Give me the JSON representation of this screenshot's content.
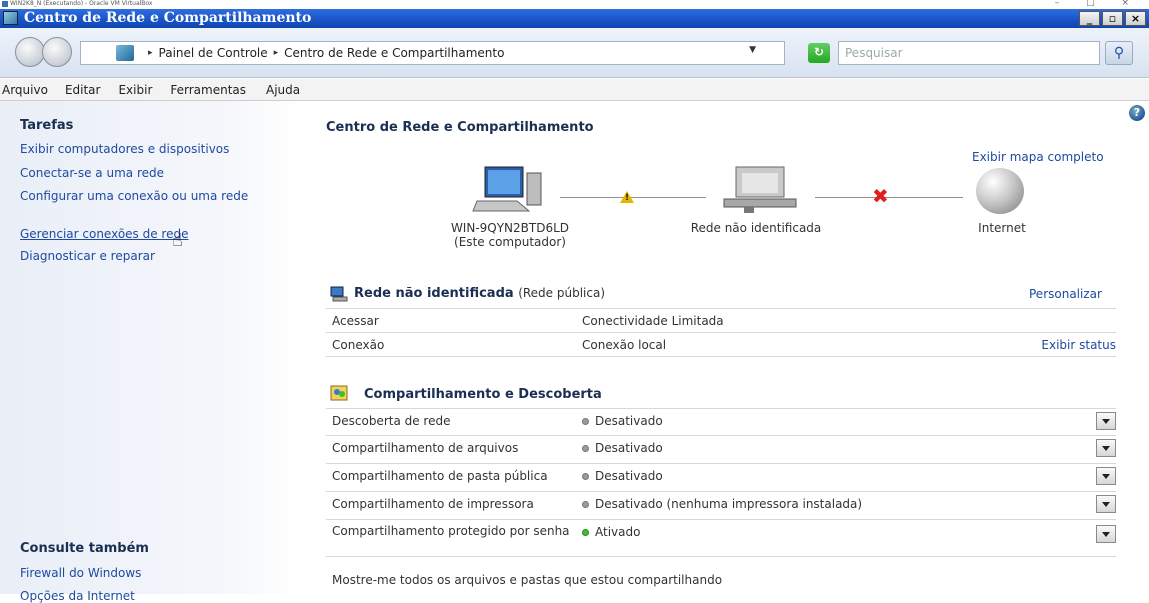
{
  "vm": {
    "title": "WIN2K8_N (Executando) - Oracle VM VirtualBox",
    "controls": "– □ ×"
  },
  "window": {
    "title": "Centro de Rede e Compartilhamento",
    "min": "_",
    "max": "▫",
    "close": "×"
  },
  "address": {
    "crumbs": [
      "Painel de Controle",
      "Centro de Rede e Compartilhamento"
    ],
    "search_placeholder": "Pesquisar"
  },
  "menu": [
    "Arquivo",
    "Editar",
    "Exibir",
    "Ferramentas",
    "Ajuda"
  ],
  "sidebar": {
    "tasks_title": "Tarefas",
    "tasks": [
      "Exibir computadores e dispositivos",
      "Conectar-se a uma rede",
      "Configurar uma conexão ou uma rede",
      "Gerenciar conexões de rede",
      "Diagnosticar e reparar"
    ],
    "see_also_title": "Consulte também",
    "see_also": [
      "Firewall do Windows",
      "Opções da Internet"
    ]
  },
  "main": {
    "title": "Centro de Rede e Compartilhamento",
    "view_full_map": "Exibir mapa completo",
    "map": {
      "computer_name": "WIN-9QYN2BTD6LD",
      "computer_sub": "(Este computador)",
      "network": "Rede não identificada",
      "internet": "Internet"
    },
    "network_section": {
      "name": "Rede não identificada",
      "type": "(Rede pública)",
      "customize": "Personalizar",
      "rows": [
        {
          "label": "Acessar",
          "value": "Conectividade Limitada",
          "action": ""
        },
        {
          "label": "Conexão",
          "value": "Conexão local",
          "action": "Exibir status"
        }
      ]
    },
    "sharing_section": {
      "title": "Compartilhamento e Descoberta",
      "rows": [
        {
          "label": "Descoberta de rede",
          "value": "Desativado"
        },
        {
          "label": "Compartilhamento de arquivos",
          "value": "Desativado"
        },
        {
          "label": "Compartilhamento de pasta pública",
          "value": "Desativado"
        },
        {
          "label": "Compartilhamento de impressora",
          "value": "Desativado (nenhuma impressora instalada)"
        },
        {
          "label": "Compartilhamento protegido por senha",
          "value": "Ativado"
        }
      ],
      "footer_link": "Mostre-me todos os arquivos e pastas que estou compartilhando"
    }
  },
  "colors": {
    "titlebar": "#1a55c8",
    "link": "#1f4aa0",
    "status_on": "#3fbf2f",
    "warning": "#e7b400",
    "error": "#e02020"
  }
}
